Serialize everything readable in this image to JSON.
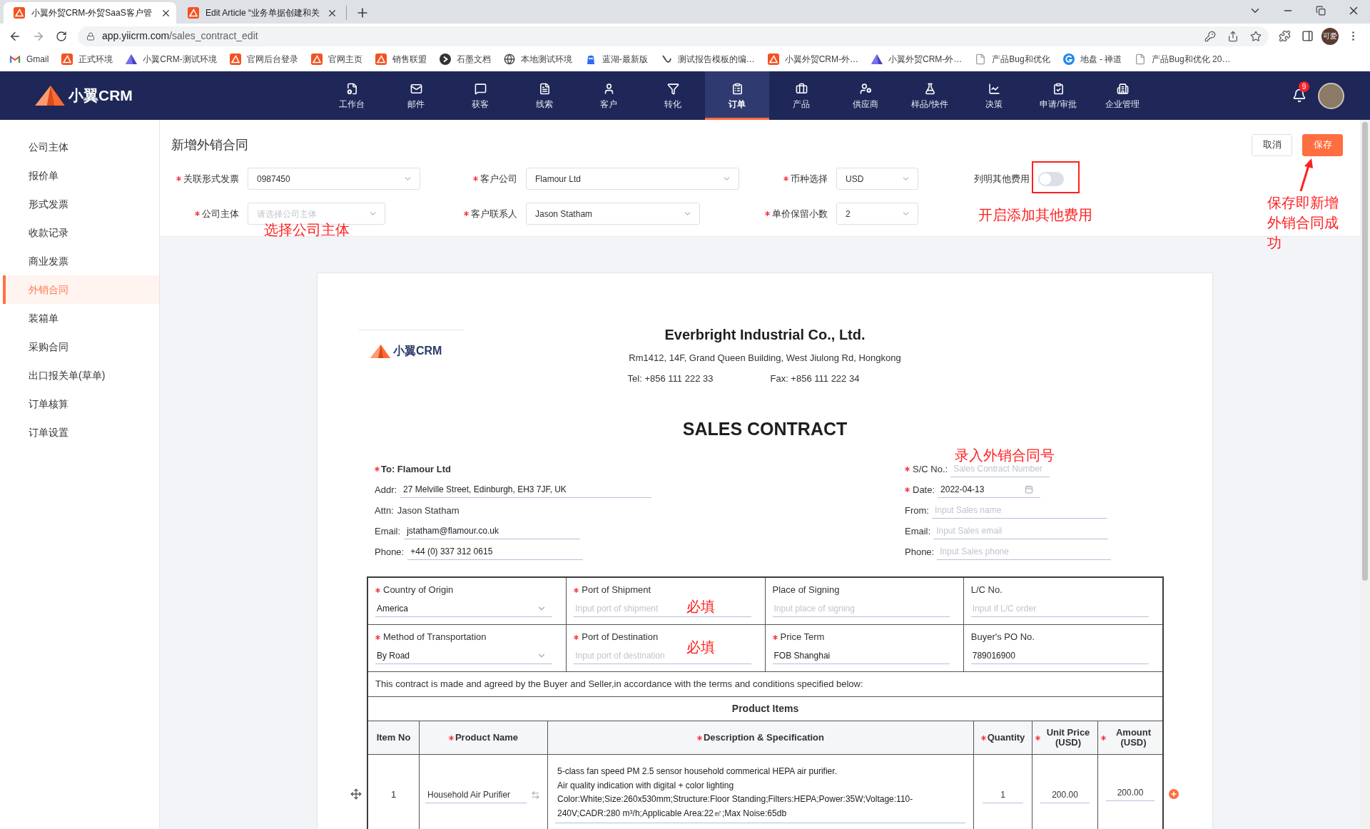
{
  "browser": {
    "tabs": [
      {
        "title": "小翼外贸CRM-外贸SaaS客户管",
        "selected": true
      },
      {
        "title": "Edit Article “业务单据创建和关",
        "selected": false
      }
    ],
    "url": {
      "host": "app.yiicrm.com",
      "path": "/sales_contract_edit"
    },
    "profile": "可爱",
    "bookmarks": [
      "Gmail",
      "正式环境",
      "小翼CRM-测试环境",
      "官网后台登录",
      "官网主页",
      "销售联盟",
      "石墨文档",
      "本地测试环境",
      "蓝湖-最新版",
      "测试报告模板的编…",
      "小翼外贸CRM-外…",
      "小翼外贸CRM-外…",
      "产品Bug和优化",
      "地盘 - 禅道",
      "产品Bug和优化 20…"
    ]
  },
  "app": {
    "logo": "小翼CRM",
    "nav": [
      {
        "label": "工作台",
        "selected": false
      },
      {
        "label": "邮件",
        "selected": false
      },
      {
        "label": "获客",
        "selected": false
      },
      {
        "label": "线索",
        "selected": false
      },
      {
        "label": "客户",
        "selected": false
      },
      {
        "label": "转化",
        "selected": false
      },
      {
        "label": "订单",
        "selected": true
      },
      {
        "label": "产品",
        "selected": false
      },
      {
        "label": "供应商",
        "selected": false
      },
      {
        "label": "样品/快件",
        "selected": false
      },
      {
        "label": "决策",
        "selected": false
      },
      {
        "label": "申请/审批",
        "selected": false
      },
      {
        "label": "企业管理",
        "selected": false
      }
    ],
    "notifications": "9"
  },
  "sidebar": [
    {
      "label": "公司主体",
      "selected": false
    },
    {
      "label": "报价单",
      "selected": false
    },
    {
      "label": "形式发票",
      "selected": false
    },
    {
      "label": "收款记录",
      "selected": false
    },
    {
      "label": "商业发票",
      "selected": false
    },
    {
      "label": "外销合同",
      "selected": true
    },
    {
      "label": "装箱单",
      "selected": false
    },
    {
      "label": "采购合同",
      "selected": false
    },
    {
      "label": "出口报关单(草单)",
      "selected": false
    },
    {
      "label": "订单核算",
      "selected": false
    },
    {
      "label": "订单设置",
      "selected": false
    }
  ],
  "form": {
    "title": "新增外销合同",
    "buttons": [
      {
        "label": "取消",
        "kind": "secondary"
      },
      {
        "label": "保存",
        "kind": "primary"
      }
    ],
    "rows": [
      [
        {
          "kind": "select",
          "label": "关联形式发票",
          "required": true,
          "value": "0987450"
        },
        {
          "kind": "select",
          "label": "客户公司",
          "required": true,
          "value": "Flamour Ltd"
        },
        {
          "kind": "select",
          "label": "币种选择",
          "required": true,
          "value": "USD"
        },
        {
          "kind": "switch",
          "label": "列明其他费用",
          "required": false,
          "on": false
        }
      ],
      [
        {
          "kind": "select",
          "label": "公司主体",
          "required": true,
          "placeholder": "请选择公司主体"
        },
        {
          "kind": "select",
          "label": "客户联系人",
          "required": true,
          "value": "Jason Statham"
        },
        {
          "kind": "select",
          "label": "单价保留小数",
          "required": true,
          "value": "2"
        }
      ]
    ]
  },
  "document": {
    "logo": "小翼CRM",
    "company": "Everbright Industrial Co., Ltd.",
    "address": "Rm1412, 14F, Grand Queen Building, West Jiulong Rd, Hongkong",
    "tel": "Tel: +856 111 222 33",
    "fax": "Fax: +856 111 222 34",
    "title": "SALES CONTRACT",
    "buyer": {
      "label": "To:",
      "name": "Flamour Ltd",
      "required": true,
      "fields": [
        {
          "kind": "input",
          "label": "Addr:",
          "value": "27 Melville Street, Edinburgh, EH3 7JF, UK"
        },
        {
          "kind": "text",
          "label": "Attn:",
          "value": "Jason Statham"
        },
        {
          "kind": "input",
          "label": "Email:",
          "value": "jstatham@flamour.co.uk"
        },
        {
          "kind": "input",
          "label": "Phone:",
          "value": "+44 (0) 337 312 0615"
        }
      ]
    },
    "seller": [
      {
        "kind": "input",
        "label": "S/C No.:",
        "required": true,
        "placeholder": "Sales Contract Number"
      },
      {
        "kind": "date",
        "label": "Date:",
        "required": true,
        "value": "2022-04-13"
      },
      {
        "kind": "input",
        "label": "From:",
        "required": false,
        "placeholder": "Input Sales name"
      },
      {
        "kind": "input",
        "label": "Email:",
        "required": false,
        "placeholder": "Input Sales email"
      },
      {
        "kind": "input",
        "label": "Phone:",
        "required": false,
        "placeholder": "Input Sales phone"
      }
    ],
    "terms": [
      [
        {
          "kind": "select",
          "label": "Country of Origin",
          "required": true,
          "value": "America"
        },
        {
          "kind": "input",
          "label": "Port of Shipment",
          "required": true,
          "placeholder": "Input port of shipment"
        },
        {
          "kind": "input",
          "label": "Place of Signing",
          "required": false,
          "placeholder": "Input place of signing"
        },
        {
          "kind": "input",
          "label": "L/C No.",
          "required": false,
          "placeholder": "Input if L/C order"
        }
      ],
      [
        {
          "kind": "select",
          "label": "Method of Transportation",
          "required": true,
          "value": "By Road"
        },
        {
          "kind": "input",
          "label": "Port of Destination",
          "required": true,
          "placeholder": "Input port of destination"
        },
        {
          "kind": "input",
          "label": "Price Term",
          "required": true,
          "value": "FOB Shanghai"
        },
        {
          "kind": "input",
          "label": "Buyer's PO No.",
          "required": false,
          "value": "789016900"
        }
      ]
    ],
    "statement": "This contract is made and agreed by the Buyer and Seller,in accordance with the terms and conditions specified below:",
    "items_title": "Product Items",
    "columns": [
      {
        "label": "Item No",
        "required": false
      },
      {
        "label": "Product Name",
        "required": true
      },
      {
        "label": "Description & Specification",
        "required": true
      },
      {
        "label": "Quantity",
        "required": true
      },
      {
        "label": "Unit Price (USD)",
        "required": true
      },
      {
        "label": "Amount (USD)",
        "required": true
      }
    ],
    "items": [
      {
        "item_no": "1",
        "product_name": "Household Air Purifier",
        "description": "5-class fan speed PM 2.5 sensor household commerical HEPA air purifier.\nAir quality indication with digital + color lighting\nColor:White;Size:260x530mm;Structure:Floor Standing;Filters:HEPA;Power:35W;Voltage:110-240V;CADR:280 m³/h;Applicable Area:22㎡;Max Noise:65db",
        "quantity": "1",
        "unit_price": "200.00",
        "amount": "200.00"
      }
    ]
  },
  "annotations": [
    {
      "text": "选择公司主体"
    },
    {
      "text": "开启添加其他费用"
    },
    {
      "text": "保存即新增外销合同成功"
    },
    {
      "text": "录入外销合同号"
    },
    {
      "text": "必填"
    },
    {
      "text": "必填"
    }
  ]
}
